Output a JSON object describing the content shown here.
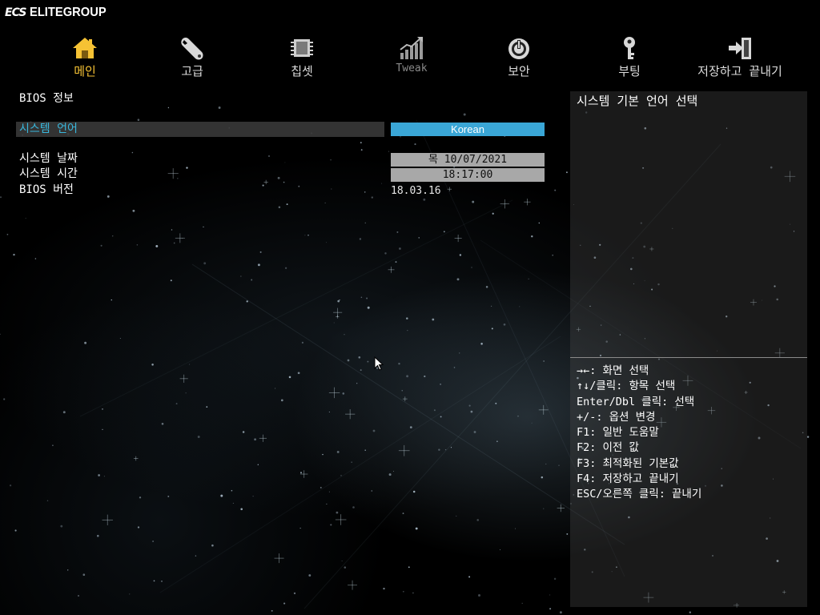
{
  "brand": {
    "badge": "ECS",
    "name": "ELITEGROUP"
  },
  "nav": {
    "items": [
      {
        "label": "메인",
        "icon": "house-icon",
        "active": true
      },
      {
        "label": "고급",
        "icon": "wrench-icon"
      },
      {
        "label": "칩셋",
        "icon": "chip-icon"
      },
      {
        "label": "Tweak",
        "icon": "performance-chart-icon"
      },
      {
        "label": "보안",
        "icon": "power-icon"
      },
      {
        "label": "부팅",
        "icon": "key-icon"
      },
      {
        "label": "저장하고 끝내기",
        "icon": "exit-icon"
      }
    ]
  },
  "main": {
    "section_title": "BIOS 정보",
    "language": {
      "label": "시스템 언어",
      "value": "Korean"
    },
    "date": {
      "label": "시스템 날짜",
      "value": "목 10/07/2021"
    },
    "time": {
      "label": "시스템 시간",
      "value": "18:17:00"
    },
    "bios_version": {
      "label": "BIOS 버전",
      "value": "18.03.16"
    }
  },
  "side": {
    "help_title": "시스템 기본 언어 선택",
    "hints": [
      "→←: 화면 선택",
      "↑↓/클릭: 항목 선택",
      "Enter/Dbl 클릭: 선택",
      "+/-: 옵션 변경",
      "F1: 일반 도움말",
      "F2: 이전 값",
      "F3: 최적화된 기본값",
      "F4: 저장하고 끝내기",
      "ESC/오른쪽 클릭: 끝내기"
    ]
  },
  "colors": {
    "accent_active": "#f6c234",
    "selected_text": "#39b7dc",
    "language_box": "#3aa6d6",
    "value_box": "#a8a8a8"
  }
}
